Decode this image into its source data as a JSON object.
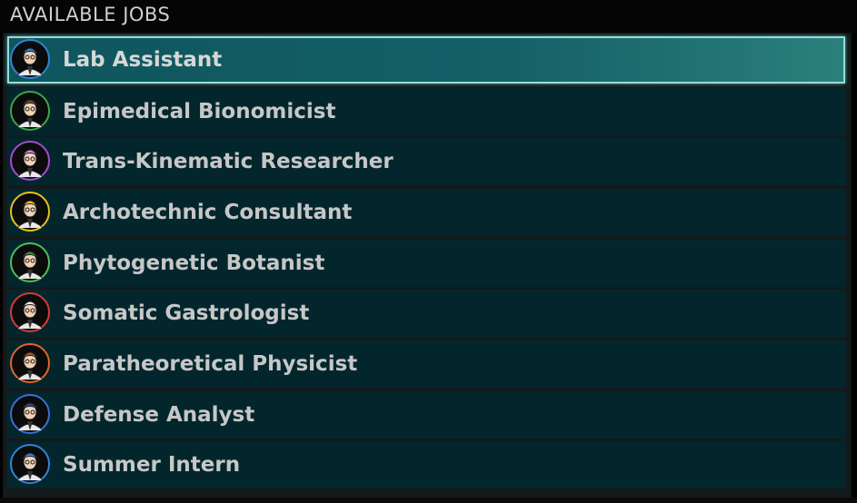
{
  "header": {
    "title": "AVAILABLE JOBS"
  },
  "jobs": [
    {
      "label": "Lab Assistant",
      "icon": "lab-assistant-portrait-icon",
      "ring": "#2d86d6",
      "hat": "#2d86d6",
      "selected": true
    },
    {
      "label": "Epimedical Bionomicist",
      "icon": "epimedical-bionomicist-portrait-icon",
      "ring": "#3aa845",
      "hat": "#6b4a2a"
    },
    {
      "label": "Trans-Kinematic Researcher",
      "icon": "trans-kinematic-researcher-portrait-icon",
      "ring": "#a54ad3",
      "hat": "#c98ae6"
    },
    {
      "label": "Archotechnic Consultant",
      "icon": "archotechnic-consultant-portrait-icon",
      "ring": "#e6c21d",
      "hat": "#f0c419"
    },
    {
      "label": "Phytogenetic Botanist",
      "icon": "phytogenetic-botanist-portrait-icon",
      "ring": "#4fbe5a",
      "hat": "#3c8a3a"
    },
    {
      "label": "Somatic Gastrologist",
      "icon": "somatic-gastrologist-portrait-icon",
      "ring": "#d63a3a",
      "hat": "#e8e8e8"
    },
    {
      "label": "Paratheoretical Physicist",
      "icon": "paratheoretical-physicist-portrait-icon",
      "ring": "#e0662a",
      "hat": "#a9542a"
    },
    {
      "label": "Defense Analyst",
      "icon": "defense-analyst-portrait-icon",
      "ring": "#3a6fd6",
      "hat": "#2a4a8a"
    },
    {
      "label": "Summer Intern",
      "icon": "summer-intern-portrait-icon",
      "ring": "#2d86d6",
      "hat": "#2d86d6"
    }
  ],
  "colors": {
    "row_bg": "#03262d",
    "selected_bg": "#146067",
    "selected_border": "#98dcd6",
    "text": "#c7c7c7"
  }
}
